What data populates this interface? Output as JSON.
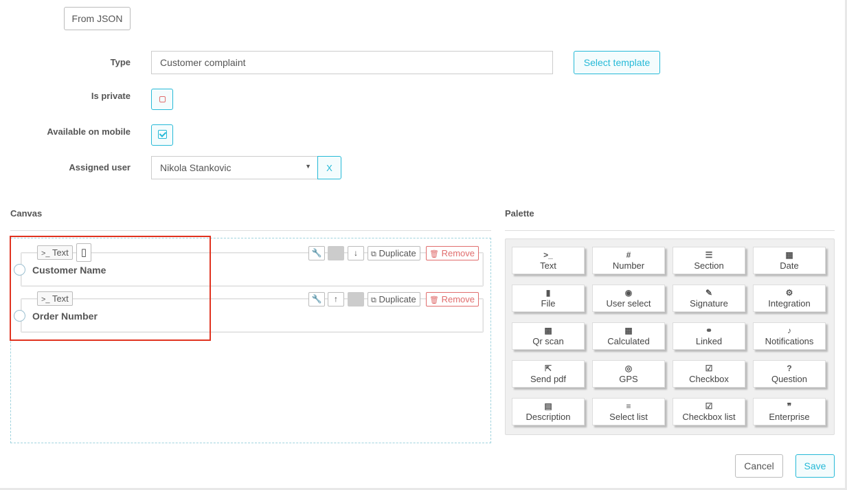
{
  "top": {
    "from_json_label": "From JSON"
  },
  "form": {
    "type_label": "Type",
    "type_value": "Customer complaint",
    "select_template_label": "Select template",
    "is_private_label": "Is private",
    "mobile_label": "Available on mobile",
    "assigned_user_label": "Assigned user",
    "assigned_user_value": "Nikola Stankovic",
    "clear_label": "X"
  },
  "canvas": {
    "title": "Canvas",
    "fields": [
      {
        "type_tag": "Text",
        "name": "Customer Name",
        "duplicate_label": "Duplicate",
        "remove_label": "Remove"
      },
      {
        "type_tag": "Text",
        "name": "Order Number",
        "duplicate_label": "Duplicate",
        "remove_label": "Remove"
      }
    ]
  },
  "palette": {
    "title": "Palette",
    "items": [
      {
        "icon": "terminal-icon",
        "glyph": ">_",
        "label": "Text"
      },
      {
        "icon": "hash-icon",
        "glyph": "#",
        "label": "Number"
      },
      {
        "icon": "section-icon",
        "glyph": "☰",
        "label": "Section"
      },
      {
        "icon": "calendar-icon",
        "glyph": "▦",
        "label": "Date"
      },
      {
        "icon": "file-icon",
        "glyph": "▮",
        "label": "File"
      },
      {
        "icon": "user-icon",
        "glyph": "◉",
        "label": "User select"
      },
      {
        "icon": "signature-icon",
        "glyph": "✎",
        "label": "Signature"
      },
      {
        "icon": "cogs-icon",
        "glyph": "⚙",
        "label": "Integration"
      },
      {
        "icon": "qrcode-icon",
        "glyph": "▩",
        "label": "Qr scan"
      },
      {
        "icon": "calculator-icon",
        "glyph": "▦",
        "label": "Calculated"
      },
      {
        "icon": "link-icon",
        "glyph": "⚭",
        "label": "Linked"
      },
      {
        "icon": "bell-icon",
        "glyph": "♪",
        "label": "Notifications"
      },
      {
        "icon": "send-pdf-icon",
        "glyph": "⇱",
        "label": "Send pdf"
      },
      {
        "icon": "compass-icon",
        "glyph": "◎",
        "label": "GPS"
      },
      {
        "icon": "checkbox-icon",
        "glyph": "☑",
        "label": "Checkbox"
      },
      {
        "icon": "question-icon",
        "glyph": "?",
        "label": "Question"
      },
      {
        "icon": "description-icon",
        "glyph": "▤",
        "label": "Description"
      },
      {
        "icon": "list-icon",
        "glyph": "≡",
        "label": "Select list"
      },
      {
        "icon": "checkbox-icon",
        "glyph": "☑",
        "label": "Checkbox list"
      },
      {
        "icon": "quote-icon",
        "glyph": "❞",
        "label": "Enterprise"
      }
    ]
  },
  "footer": {
    "cancel_label": "Cancel",
    "save_label": "Save"
  },
  "colors": {
    "accent": "#25b9d7",
    "danger": "#e06d6d",
    "highlight": "#e0321f"
  }
}
